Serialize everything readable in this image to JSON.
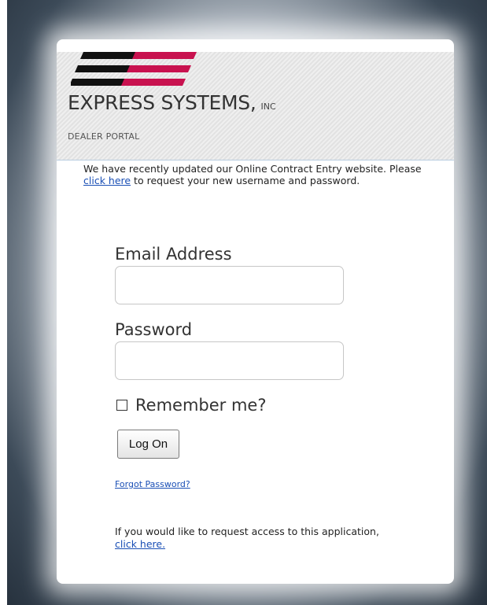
{
  "brand": {
    "company_name": "EXPRESS SYSTEMS,",
    "company_suffix": "INC",
    "portal_label": "DEALER PORTAL",
    "logo_colors": {
      "dark": "#111111",
      "accent": "#c8124f"
    }
  },
  "notice": {
    "text_before": "We have recently updated our Online Contract Entry website. Please ",
    "link_text": "click here",
    "text_after": " to request your new username and password."
  },
  "login_form": {
    "email_label": "Email Address",
    "email_value": "",
    "password_label": "Password",
    "password_value": "",
    "remember_label": "Remember me?",
    "remember_checked": false,
    "submit_label": "Log On",
    "forgot_link": "Forgot Password?"
  },
  "access_request": {
    "text_before": "If you would like to request access to this application, ",
    "link_text": "click here."
  }
}
